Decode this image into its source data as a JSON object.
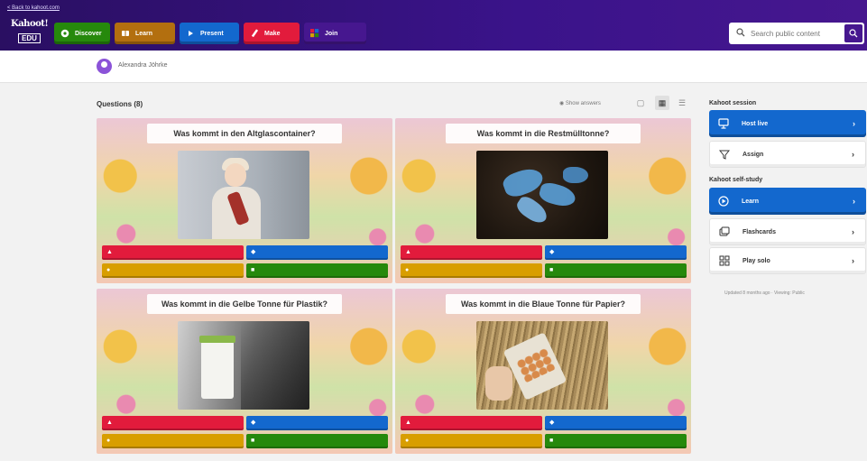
{
  "topbar": {
    "back_link": "< Back to kahoot.com",
    "logo_word": "Kahoot!",
    "logo_badge": "EDU",
    "nav": [
      {
        "label": "Discover",
        "icon": "compass-icon",
        "color": "#26890c"
      },
      {
        "label": "Learn",
        "icon": "book-icon",
        "color": "#b36f0f"
      },
      {
        "label": "Present",
        "icon": "play-icon",
        "color": "#1368ce"
      },
      {
        "label": "Make",
        "icon": "pencil-icon",
        "color": "#e21b3c"
      },
      {
        "label": "Join",
        "icon": "grid-icon",
        "color": "#864cbf"
      }
    ],
    "search_placeholder": "Search public content"
  },
  "author": {
    "name": "Alexandra Jöhrke"
  },
  "questions": {
    "heading": "Questions (8)",
    "show_answers": "Show answers",
    "items": [
      {
        "title": "Was kommt in den Altglascontainer?"
      },
      {
        "title": "Was kommt in die Restmülltonne?"
      },
      {
        "title": "Was kommt in die Gelbe Tonne für Plastik?"
      },
      {
        "title": "Was kommt in die Blaue Tonne für Papier?"
      }
    ]
  },
  "sidebar": {
    "session_heading": "Kahoot session",
    "session_buttons": [
      {
        "label": "Host live",
        "icon": "monitor-icon"
      },
      {
        "label": "Assign",
        "icon": "assign-icon"
      }
    ],
    "selfstudy_heading": "Kahoot self-study",
    "selfstudy_buttons": [
      {
        "label": "Learn",
        "icon": "learn-icon"
      },
      {
        "label": "Flashcards",
        "icon": "flashcards-icon"
      },
      {
        "label": "Play solo",
        "icon": "play-solo-icon"
      }
    ],
    "updated": "Updated 8 months ago · Viewing: Public"
  }
}
